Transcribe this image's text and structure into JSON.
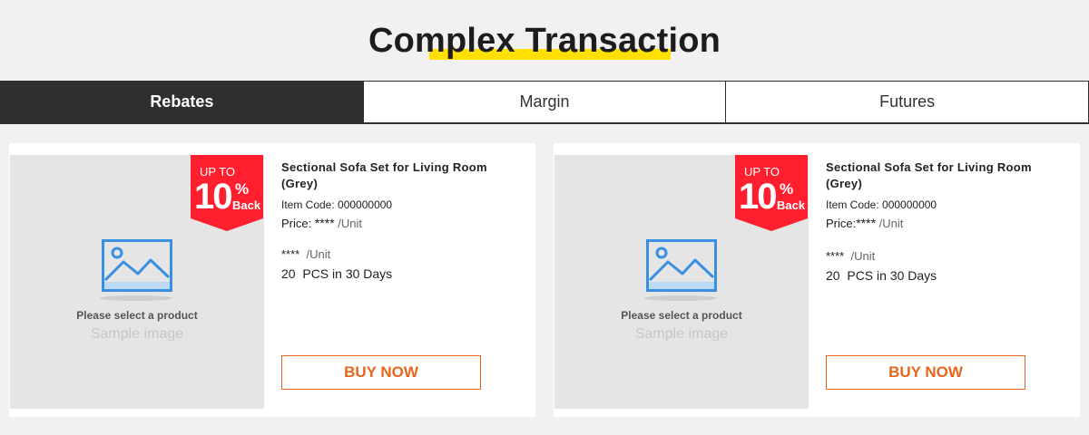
{
  "header": {
    "title": "Complex Transaction"
  },
  "tabs": [
    {
      "label": "Rebates",
      "active": true
    },
    {
      "label": "Margin",
      "active": false
    },
    {
      "label": "Futures",
      "active": false
    }
  ],
  "colors": {
    "accent": "#e5661c",
    "badge": "#ff1f2f",
    "highlight": "#ffe000",
    "tab_active": "#2f2f2f"
  },
  "cards": [
    {
      "placeholder_icon": "image-icon",
      "placeholder_text": "Please select a product",
      "placeholder_sub": "Sample image",
      "badge": {
        "up_to": "UP TO",
        "number": "10",
        "percent": "%",
        "back": "Back"
      },
      "name": "Sectional Sofa Set for Living Room (Grey)",
      "item_code": "Item Code: 000000000",
      "price_label": "Price:",
      "price_value": "****",
      "price_unit": "/Unit",
      "rebate_value": "****",
      "rebate_unit": "/Unit",
      "qty": "20",
      "qty_text": "PCS in 30 Days",
      "buy_label": "BUY NOW"
    },
    {
      "placeholder_icon": "image-icon",
      "placeholder_text": "Please select a product",
      "placeholder_sub": "Sample image",
      "badge": {
        "up_to": "UP TO",
        "number": "10",
        "percent": "%",
        "back": "Back"
      },
      "name": "Sectional Sofa Set for Living Room (Grey)",
      "item_code": "Item Code: 000000000",
      "price_label": "Price:",
      "price_value": "****",
      "price_unit": "/Unit",
      "rebate_value": "****",
      "rebate_unit": "/Unit",
      "qty": "20",
      "qty_text": "PCS in 30 Days",
      "buy_label": "BUY NOW"
    }
  ]
}
